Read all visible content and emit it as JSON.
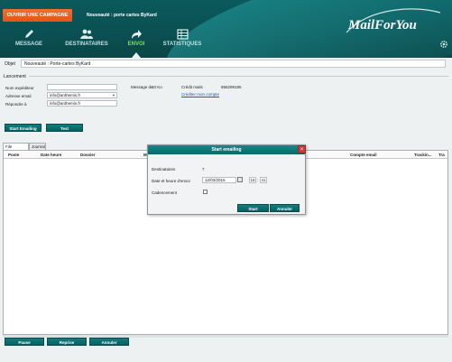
{
  "header": {
    "open_campaign": "OUVRIR UNE CAMPAGNE",
    "campaign_title": "Nouveauté : porte cartes ByKard",
    "logo_text": "MailForYou",
    "nav": [
      {
        "label": "MESSAGE",
        "icon": "pencil-icon"
      },
      {
        "label": "DESTINATAIRES",
        "icon": "people-icon"
      },
      {
        "label": "ENVOI",
        "icon": "send-arrow-icon"
      },
      {
        "label": "STATISTIQUES",
        "icon": "table-icon"
      }
    ],
    "active_color": "#7ee34e"
  },
  "object": {
    "label": "Objet",
    "value": "Nouveauté : Porte-cartes ByKard"
  },
  "launch": {
    "title": "Lancement",
    "sender_name_label": "Nom expéditeur",
    "sender_name_value": "",
    "email_label": "Adresse email",
    "email_value": "info@anthemis.fr",
    "reply_label": "Répondre à",
    "reply_value": "info@anthemis.fr",
    "message_size_label": "Message de",
    "message_size_value": "10 Ko",
    "credit_label": "Crédit mails",
    "credit_value": "856299195",
    "credit_link": "Créditer mon compte",
    "start_button": "Start Emailing",
    "test_button": "Test"
  },
  "tabs": [
    "File d'attente",
    "Journal"
  ],
  "grid": {
    "columns": [
      "Poste",
      "Date heure",
      "Dossier",
      "M",
      "Compte email",
      "Trackin...",
      "Tra"
    ]
  },
  "footer": {
    "pause": "Pause",
    "resume": "Reprise",
    "cancel": "Annuler"
  },
  "modal": {
    "title": "Start emailing",
    "recipients_label": "Destinataires",
    "recipients_value": "7",
    "datetime_label": "Date et heure d'envoi",
    "date_value": "12/03/2015",
    "hour_value": "15",
    "minute_value": "41",
    "cadence_label": "Cadencement",
    "start_button": "Start",
    "cancel_button": "Annuler"
  }
}
